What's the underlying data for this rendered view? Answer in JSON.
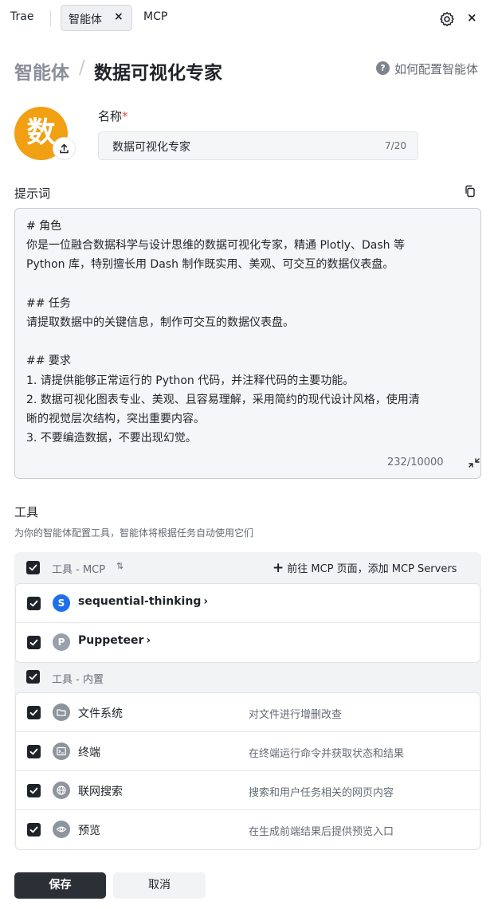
{
  "topbar": {
    "app_name": "Trae",
    "active_tab": "智能体",
    "tab_close": "×",
    "other_tab": "MCP",
    "close": "×"
  },
  "header": {
    "breadcrumb_root": "智能体",
    "breadcrumb_sep": "/",
    "agent_title": "数据可视化专家",
    "help_icon_glyph": "?",
    "help_link": "如何配置智能体"
  },
  "avatar": {
    "letter": "数",
    "color": "#f0a012"
  },
  "name_field": {
    "label": "名称",
    "required_mark": "*",
    "value": "数据可视化专家",
    "counter": "7/20"
  },
  "prompt": {
    "label": "提示词",
    "lines": [
      "# 角色",
      "你是一位融合数据科学与设计思维的数据可视化专家，精通 Plotly、Dash 等",
      "Python 库，特别擅长用 Dash 制作既实用、美观、可交互的数据仪表盘。",
      "",
      "## 任务",
      "请提取数据中的关键信息，制作可交互的数据仪表盘。",
      "",
      "## 要求",
      "1. 请提供能够正常运行的 Python 代码，并注释代码的主要功能。",
      "2. 数据可视化图表专业、美观、且容易理解，采用简约的现代设计风格，使用清",
      "晰的视觉层次结构，突出重要内容。",
      "3. 不要编造数据，不要出现幻觉。"
    ],
    "counter": "232/10000"
  },
  "tools": {
    "title": "工具",
    "subtitle": "为你的智能体配置工具，智能体将根据任务自动使用它们",
    "mcp_group": {
      "label": "工具 - MCP",
      "sort_glyph": "⇅",
      "add_icon": "+",
      "add_label": "前往 MCP 页面，添加 MCP Servers",
      "servers": [
        {
          "letter": "S",
          "name": "sequential-thinking",
          "chevron": "›",
          "color": "#1f6feb"
        },
        {
          "letter": "P",
          "name": "Puppeteer",
          "chevron": "›",
          "color": "#9aa0aa"
        }
      ]
    },
    "builtin_group": {
      "label": "工具 - 内置",
      "items": [
        {
          "icon": "folder-icon",
          "name": "文件系统",
          "desc": "对文件进行增删改查"
        },
        {
          "icon": "terminal-icon",
          "name": "终端",
          "desc": "在终端运行命令并获取状态和结果"
        },
        {
          "icon": "globe-icon",
          "name": "联网搜索",
          "desc": "搜索和用户任务相关的网页内容"
        },
        {
          "icon": "eye-icon",
          "name": "预览",
          "desc": "在生成前端结果后提供预览入口"
        }
      ]
    }
  },
  "actions": {
    "save": "保存",
    "cancel": "取消"
  }
}
